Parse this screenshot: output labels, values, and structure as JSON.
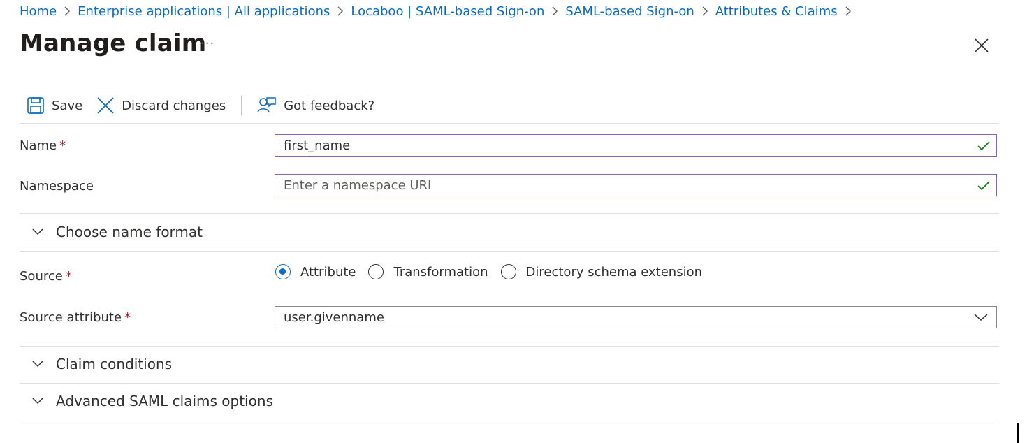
{
  "breadcrumb": {
    "items": [
      "Home",
      "Enterprise applications | All applications",
      "Locaboo | SAML-based Sign-on",
      "SAML-based Sign-on",
      "Attributes & Claims"
    ]
  },
  "page": {
    "title": "Manage claim",
    "more": "···"
  },
  "toolbar": {
    "save": "Save",
    "discard": "Discard changes",
    "feedback": "Got feedback?"
  },
  "form": {
    "name_label": "Name",
    "name_value": "first_name",
    "namespace_label": "Namespace",
    "namespace_placeholder": "Enter a namespace URI",
    "name_format_section": "Choose name format",
    "source_label": "Source",
    "source_options": [
      "Attribute",
      "Transformation",
      "Directory schema extension"
    ],
    "source_selected": "Attribute",
    "source_attribute_label": "Source attribute",
    "source_attribute_value": "user.givenname",
    "claim_conditions_section": "Claim conditions",
    "advanced_section": "Advanced SAML claims options",
    "required_marker": "*"
  },
  "colors": {
    "link": "#0f6cbd",
    "focus_border": "#8764b8",
    "check": "#107c10",
    "required": "#a4262c"
  }
}
